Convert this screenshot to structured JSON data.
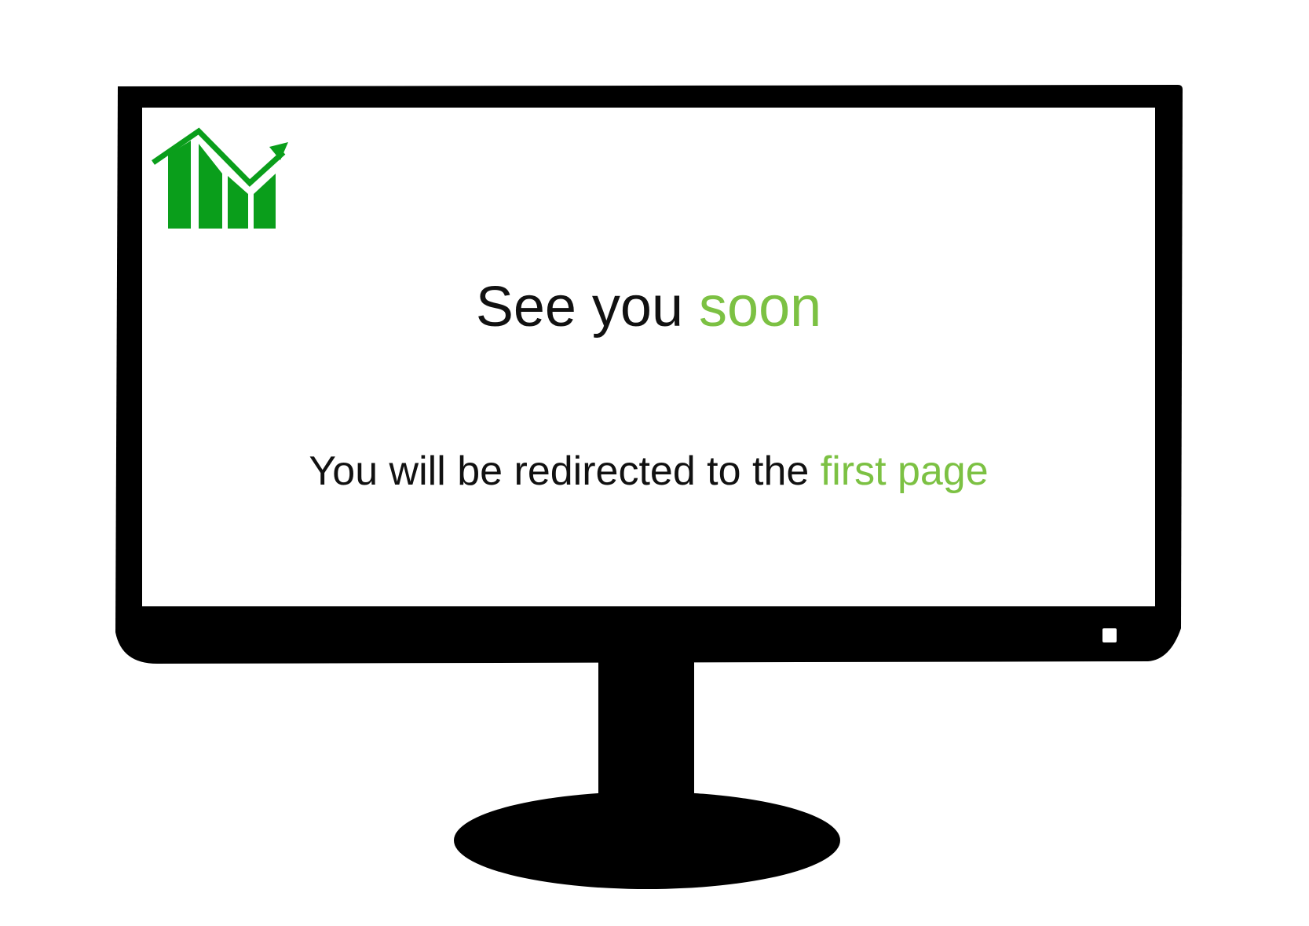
{
  "screen": {
    "logo_icon": "rising-bar-chart-icon",
    "headline": {
      "prefix": "See you",
      "highlight": "soon"
    },
    "message": {
      "prefix": "You will be redirected to the",
      "highlight": "first page"
    }
  },
  "colors": {
    "accent": "#7cc143",
    "logo": "#0a9e1b",
    "monitor": "#000000",
    "text": "#111111"
  }
}
